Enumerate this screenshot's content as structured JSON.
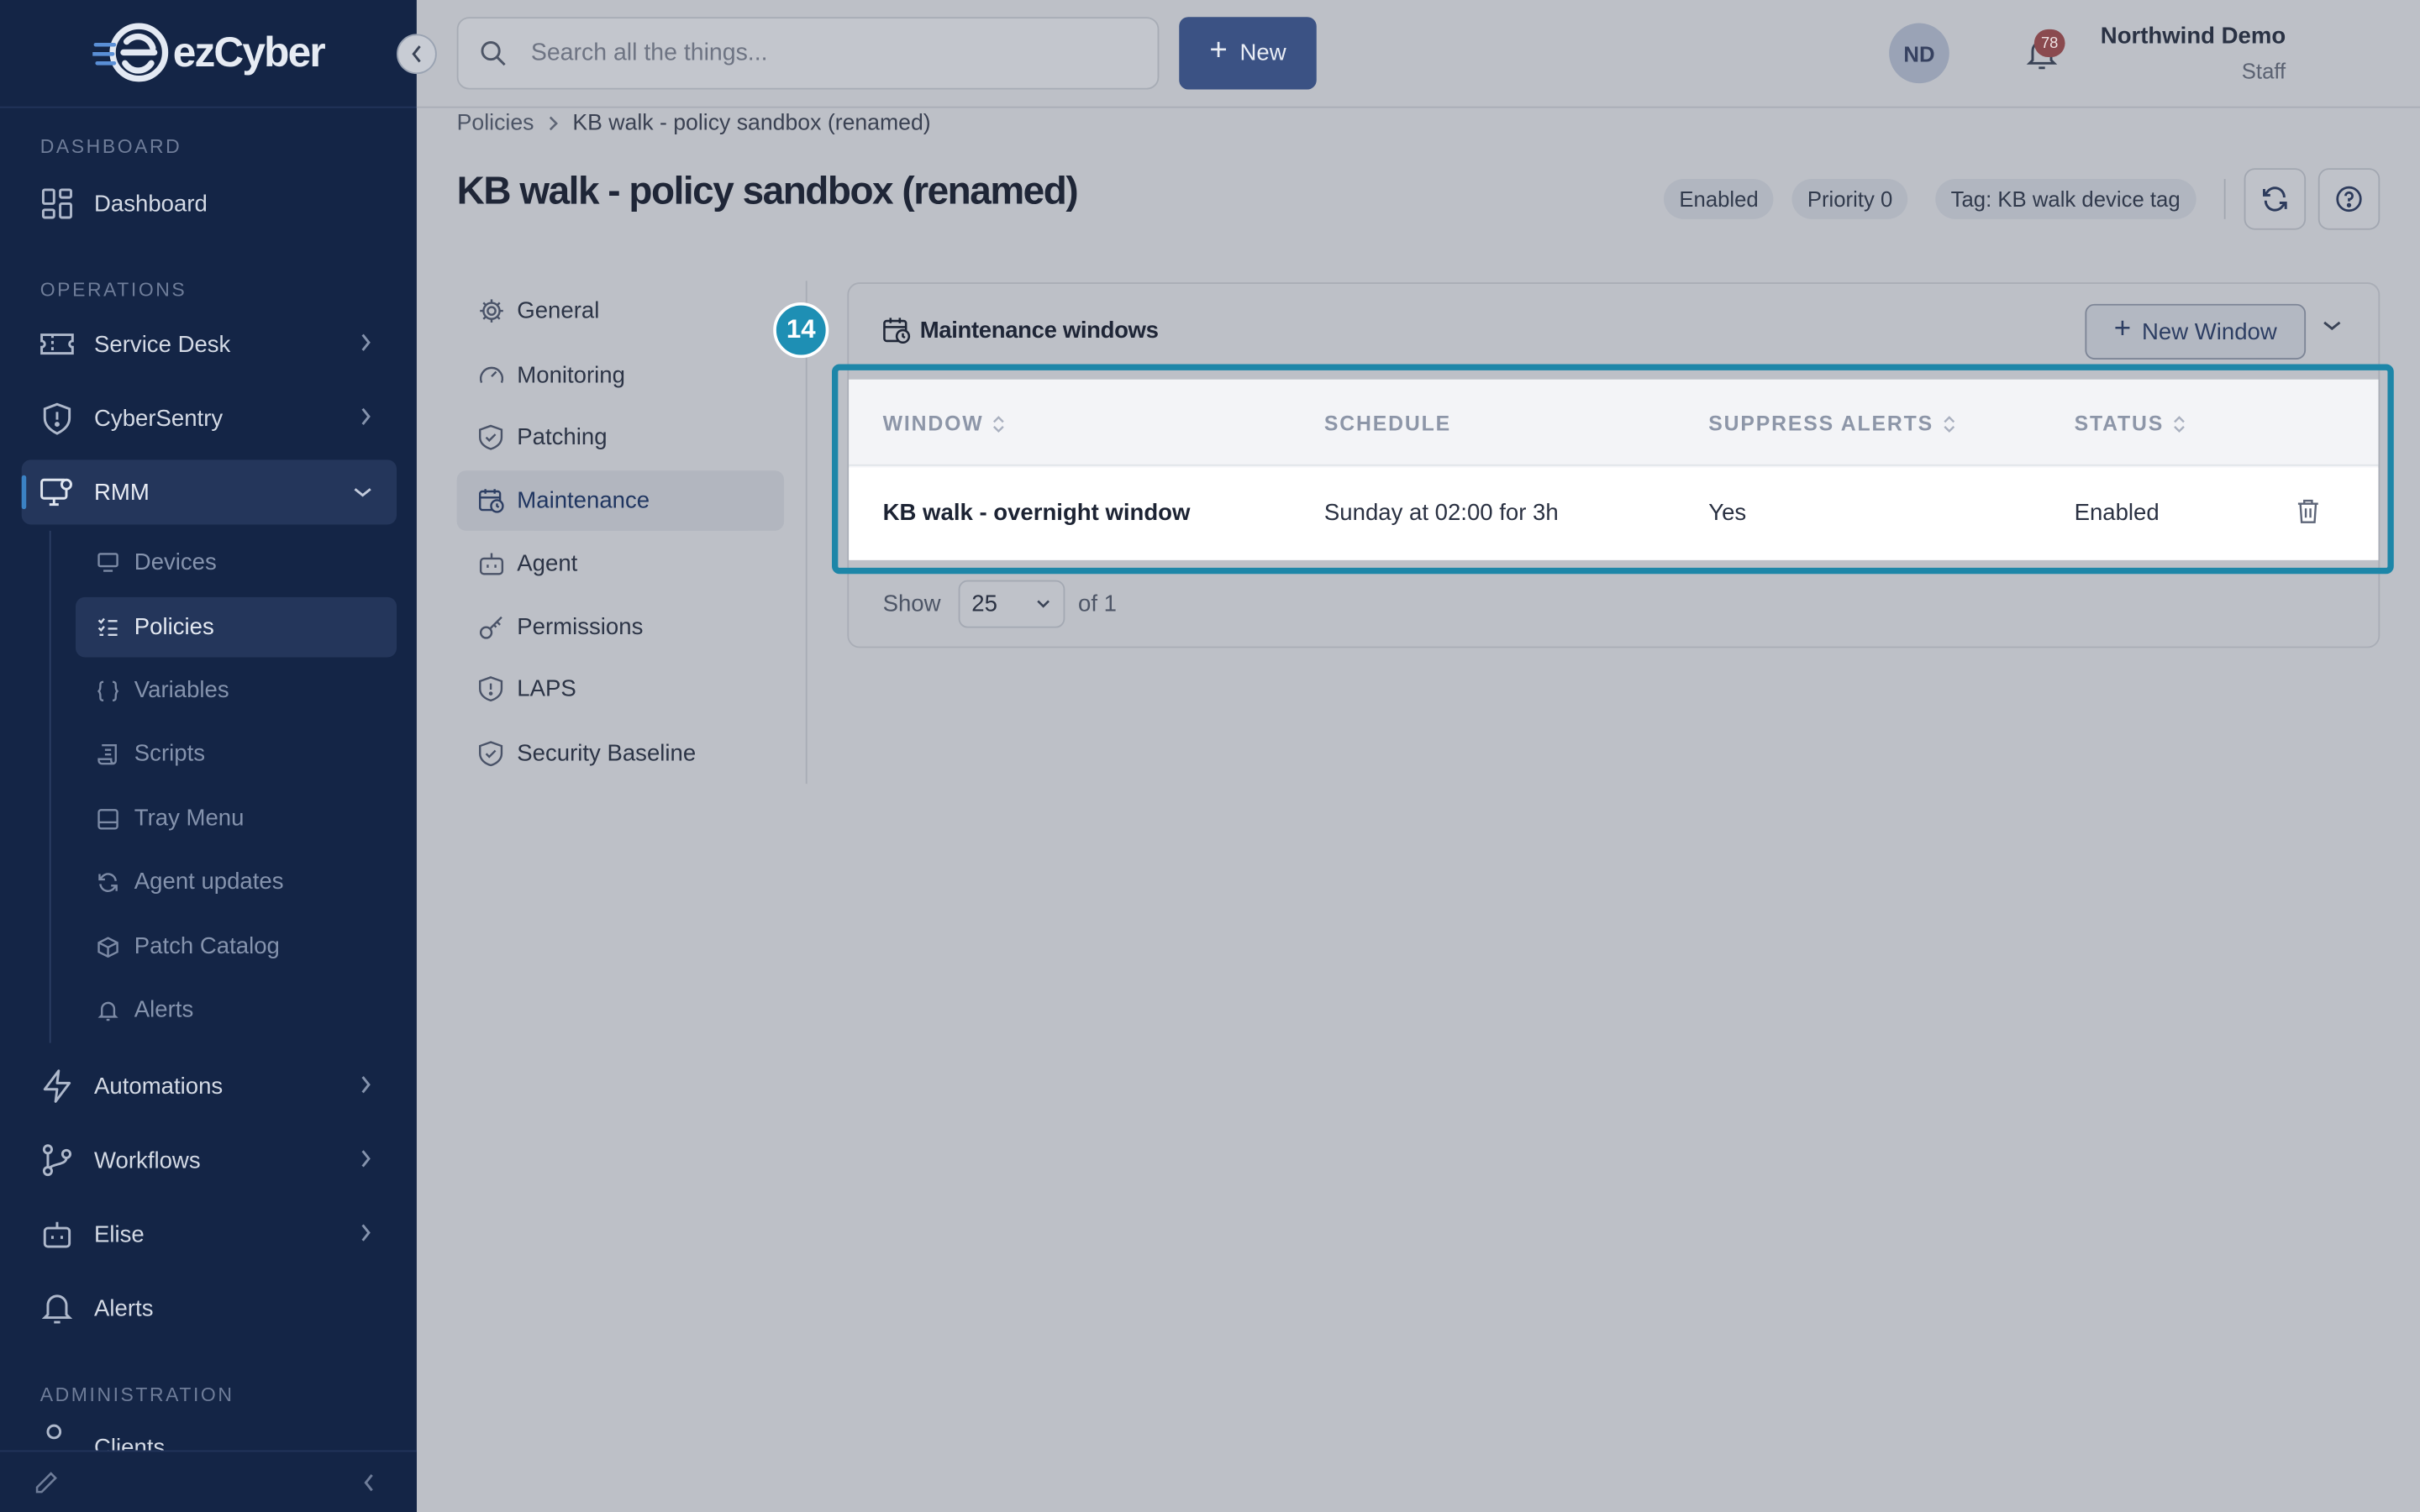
{
  "brand": {
    "name": "ezCyber"
  },
  "sidebar": {
    "sections": {
      "dashboard": "DASHBOARD",
      "operations": "OPERATIONS",
      "administration": "ADMINISTRATION"
    },
    "items": {
      "dashboard": "Dashboard",
      "service_desk": "Service Desk",
      "cybersentry": "CyberSentry",
      "rmm": "RMM",
      "automations": "Automations",
      "workflows": "Workflows",
      "elise": "Elise",
      "alerts": "Alerts",
      "clients": "Clients"
    },
    "rmm_sub": {
      "devices": "Devices",
      "policies": "Policies",
      "variables": "Variables",
      "scripts": "Scripts",
      "tray_menu": "Tray Menu",
      "agent_updates": "Agent updates",
      "patch_catalog": "Patch Catalog",
      "alerts": "Alerts"
    },
    "active_item": "RMM",
    "active_sub_item": "Policies"
  },
  "topbar": {
    "search_placeholder": "Search all the things...",
    "new_label": "New",
    "notification_count": "78",
    "user_name": "Northwind Demo",
    "user_role": "Staff",
    "avatar_initials": "ND"
  },
  "breadcrumb": {
    "parent": "Policies",
    "current": "KB walk - policy sandbox (renamed)"
  },
  "page": {
    "title": "KB walk - policy sandbox (renamed)",
    "pills": {
      "status": "Enabled",
      "priority": "Priority 0",
      "tag": "Tag: KB walk device tag"
    }
  },
  "tabs": {
    "general": "General",
    "monitoring": "Monitoring",
    "patching": "Patching",
    "maintenance": "Maintenance",
    "agent": "Agent",
    "permissions": "Permissions",
    "laps": "LAPS",
    "security_baseline": "Security Baseline",
    "active": "Maintenance"
  },
  "maintenance": {
    "title": "Maintenance windows",
    "new_window_label": "New Window",
    "columns": {
      "window": "WINDOW",
      "schedule": "SCHEDULE",
      "suppress_alerts": "SUPPRESS ALERTS",
      "status": "STATUS"
    },
    "rows": [
      {
        "window": "KB walk - overnight window",
        "schedule": "Sunday at 02:00 for 3h",
        "suppress_alerts": "Yes",
        "status": "Enabled"
      }
    ],
    "pagination": {
      "show_label": "Show",
      "page_size": "25",
      "of_label": "of 1"
    }
  },
  "annotation": {
    "step_number": "14"
  },
  "colors": {
    "sidebar_bg": "#142546",
    "primary_button": "#3b5284",
    "highlight": "#1d86a8",
    "notification_badge": "#8a4a4f"
  }
}
